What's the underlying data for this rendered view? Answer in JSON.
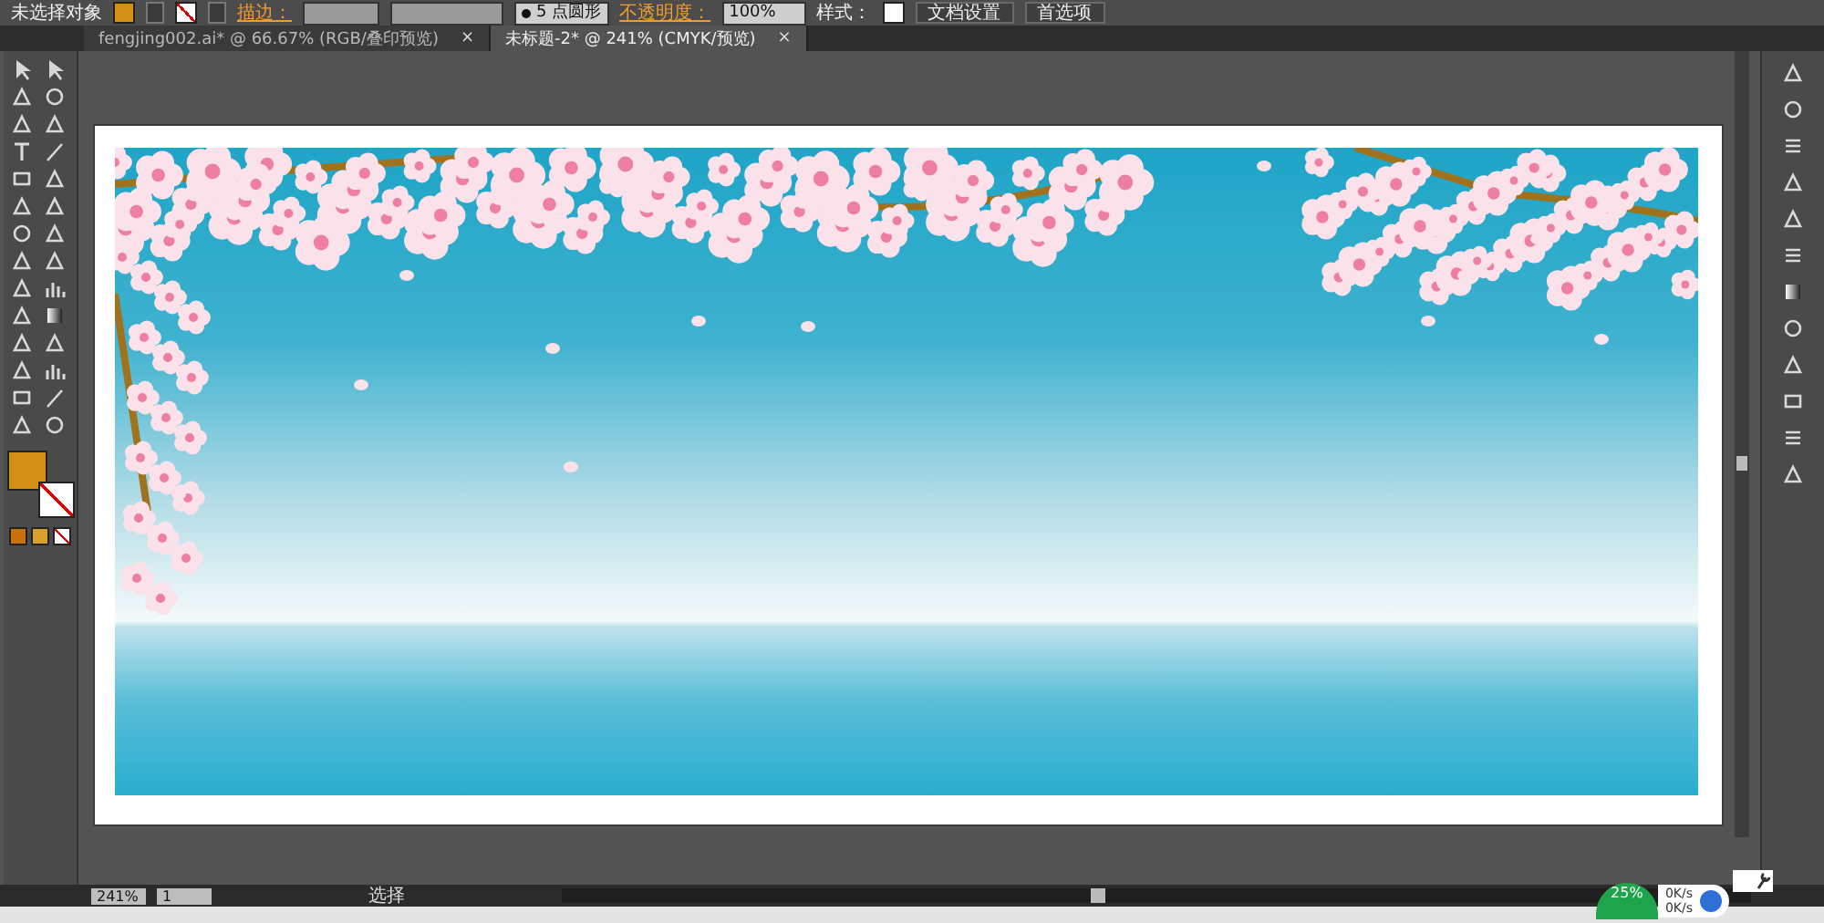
{
  "control_bar": {
    "selection": "未选择对象",
    "stroke_label": "描边：",
    "brush": "5 点圆形",
    "opacity_label": "不透明度：",
    "opacity_value": "100%",
    "style_label": "样式：",
    "buttons": [
      "文档设置",
      "首选项"
    ]
  },
  "tabs": [
    {
      "label": "fengjing002.ai* @ 66.67% (RGB/叠印预览)",
      "close": "×",
      "selected": false
    },
    {
      "label": "未标题-2* @ 241% (CMYK/预览)",
      "close": "×",
      "selected": true
    }
  ],
  "status_bar": {
    "zoom": "241%",
    "artboard": "1",
    "tool": "选择"
  },
  "network_widget": {
    "percent": "25%",
    "upload": "0K/s",
    "download": "0K/s"
  }
}
